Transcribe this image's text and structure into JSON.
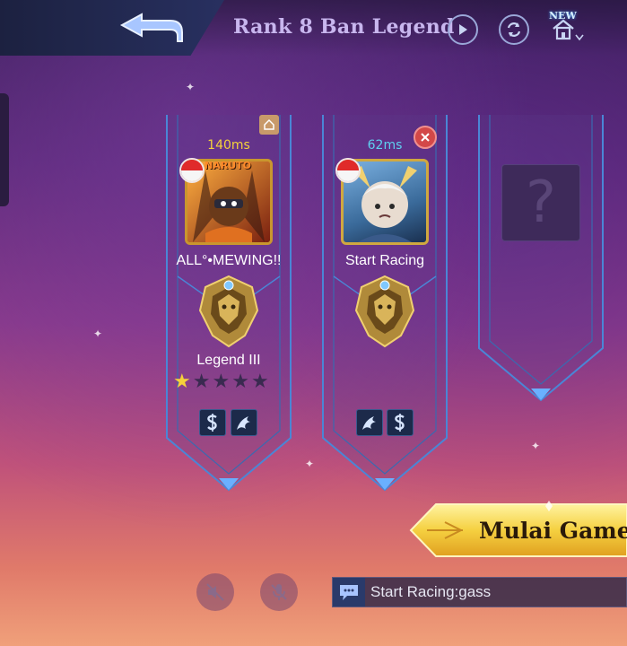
{
  "header": {
    "title": "Rank 8 Ban Legend",
    "new_badge": "NEW",
    "icons": [
      "back-arrow-icon",
      "play-icon",
      "refresh-icon",
      "home-icon"
    ]
  },
  "slots": [
    {
      "ping": "140ms",
      "ping_color": "#f5d23a",
      "player_name": "ALL°•MEWING!!",
      "avatar_badge": "NARUTO",
      "rank": "Legend III",
      "stars_filled": 1,
      "stars_total": 5,
      "spells": [
        "purify-spell-icon",
        "retribution-spell-icon"
      ]
    },
    {
      "ping": "62ms",
      "ping_color": "#5fd0f0",
      "player_name": "Start Racing",
      "rank": "",
      "spells": [
        "retribution-spell-icon",
        "purify-spell-icon"
      ]
    },
    {
      "empty_label": "?"
    }
  ],
  "actions": {
    "start_label": "Mulai Game"
  },
  "chat": {
    "message": "Start Racing:gass"
  },
  "colors": {
    "frame": "#4a86d6",
    "accent_gold": "#f0c040",
    "kick": "#d34848"
  }
}
